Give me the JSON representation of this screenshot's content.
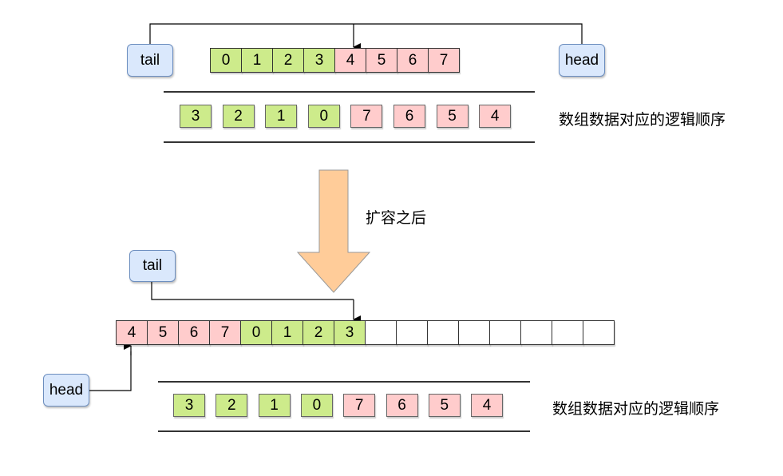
{
  "before": {
    "tail_label": "tail",
    "head_label": "head",
    "array": [
      {
        "value": "0",
        "group": "g"
      },
      {
        "value": "1",
        "group": "g"
      },
      {
        "value": "2",
        "group": "g"
      },
      {
        "value": "3",
        "group": "g"
      },
      {
        "value": "4",
        "group": "r"
      },
      {
        "value": "5",
        "group": "r"
      },
      {
        "value": "6",
        "group": "r"
      },
      {
        "value": "7",
        "group": "r"
      }
    ],
    "logical_order": [
      {
        "value": "3",
        "group": "g"
      },
      {
        "value": "2",
        "group": "g"
      },
      {
        "value": "1",
        "group": "g"
      },
      {
        "value": "0",
        "group": "g"
      },
      {
        "value": "7",
        "group": "r"
      },
      {
        "value": "6",
        "group": "r"
      },
      {
        "value": "5",
        "group": "r"
      },
      {
        "value": "4",
        "group": "r"
      }
    ],
    "caption": "数组数据对应的逻辑顺序"
  },
  "transition": {
    "label": "扩容之后"
  },
  "after": {
    "tail_label": "tail",
    "head_label": "head",
    "array": [
      {
        "value": "4",
        "group": "r"
      },
      {
        "value": "5",
        "group": "r"
      },
      {
        "value": "6",
        "group": "r"
      },
      {
        "value": "7",
        "group": "r"
      },
      {
        "value": "0",
        "group": "g"
      },
      {
        "value": "1",
        "group": "g"
      },
      {
        "value": "2",
        "group": "g"
      },
      {
        "value": "3",
        "group": "g"
      },
      {
        "value": "",
        "group": "e"
      },
      {
        "value": "",
        "group": "e"
      },
      {
        "value": "",
        "group": "e"
      },
      {
        "value": "",
        "group": "e"
      },
      {
        "value": "",
        "group": "e"
      },
      {
        "value": "",
        "group": "e"
      },
      {
        "value": "",
        "group": "e"
      },
      {
        "value": "",
        "group": "e"
      }
    ],
    "logical_order": [
      {
        "value": "3",
        "group": "g"
      },
      {
        "value": "2",
        "group": "g"
      },
      {
        "value": "1",
        "group": "g"
      },
      {
        "value": "0",
        "group": "g"
      },
      {
        "value": "7",
        "group": "r"
      },
      {
        "value": "6",
        "group": "r"
      },
      {
        "value": "5",
        "group": "r"
      },
      {
        "value": "4",
        "group": "r"
      }
    ],
    "caption": "数组数据对应的逻辑顺序"
  },
  "colors": {
    "green_cell": "#cdeb8b",
    "red_cell": "#ffcccc",
    "pointer_fill": "#dae8fc",
    "pointer_stroke": "#6c8ebf",
    "arrow_fill": "#ffcc99"
  }
}
